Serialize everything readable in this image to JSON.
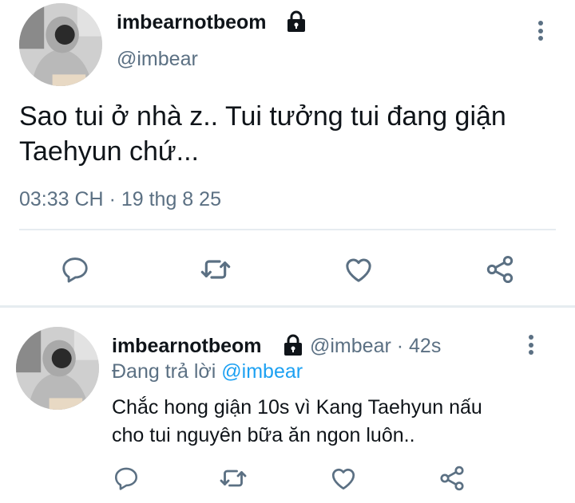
{
  "main_tweet": {
    "display_name": "imbearnotbeom",
    "handle": "@imbear",
    "text_line1": "Sao tui ở nhà z.. Tui tưởng tui đang giận",
    "text_line2": "Taehyun chứ...",
    "time": "03:33 CH",
    "separator": "·",
    "date": "19 thg 8 25"
  },
  "reply_tweet": {
    "display_name": "imbearnotbeom",
    "handle": "@imbear",
    "separator": "·",
    "age": "42s",
    "replying_prefix": "Đang trả lời",
    "replying_to": "@imbear",
    "text_line1": "Chắc hong giận 10s vì Kang Taehyun nấu",
    "text_line2": "cho tui nguyên bữa ăn ngon luôn.."
  },
  "actions": {
    "reply_icon": "speech-bubble-icon",
    "retweet_icon": "retweet-arrows-icon",
    "like_icon": "heart-icon",
    "share_icon": "share-nodes-icon"
  },
  "colors": {
    "text": "#0f1419",
    "secondary": "#5b7083",
    "accent": "#1da1f2",
    "divider": "#e6ecf0"
  }
}
